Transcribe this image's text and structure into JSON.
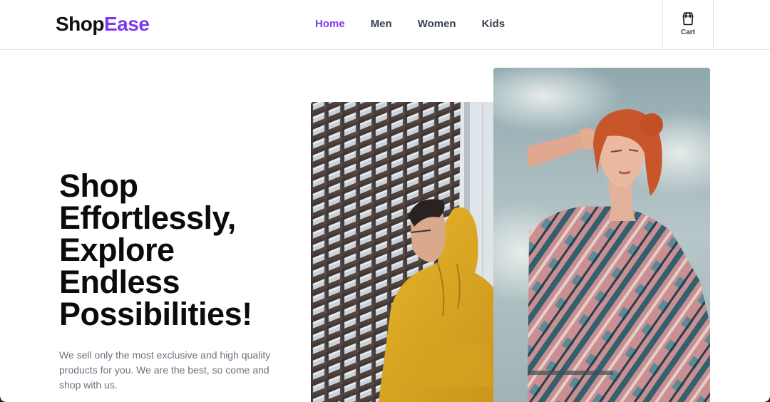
{
  "brand": {
    "part1": "Shop",
    "part2": "Ease"
  },
  "nav": {
    "items": [
      {
        "label": "Home",
        "active": true
      },
      {
        "label": "Men",
        "active": false
      },
      {
        "label": "Women",
        "active": false
      },
      {
        "label": "Kids",
        "active": false
      }
    ]
  },
  "cart": {
    "label": "Cart",
    "icon": "shopping-bag-icon"
  },
  "hero": {
    "title": "Shop Effortlessly, Explore Endless Possibilities!",
    "description": "We sell only the most exclusive and high quality products for you. We are the best, so come and shop with us."
  },
  "images": {
    "left": "man-in-yellow-hoodie-photo",
    "right": "woman-in-patterned-shirt-photo"
  },
  "colors": {
    "accent": "#7c3aed",
    "text": "#111111",
    "muted": "#6b7280",
    "nav": "#374151"
  }
}
